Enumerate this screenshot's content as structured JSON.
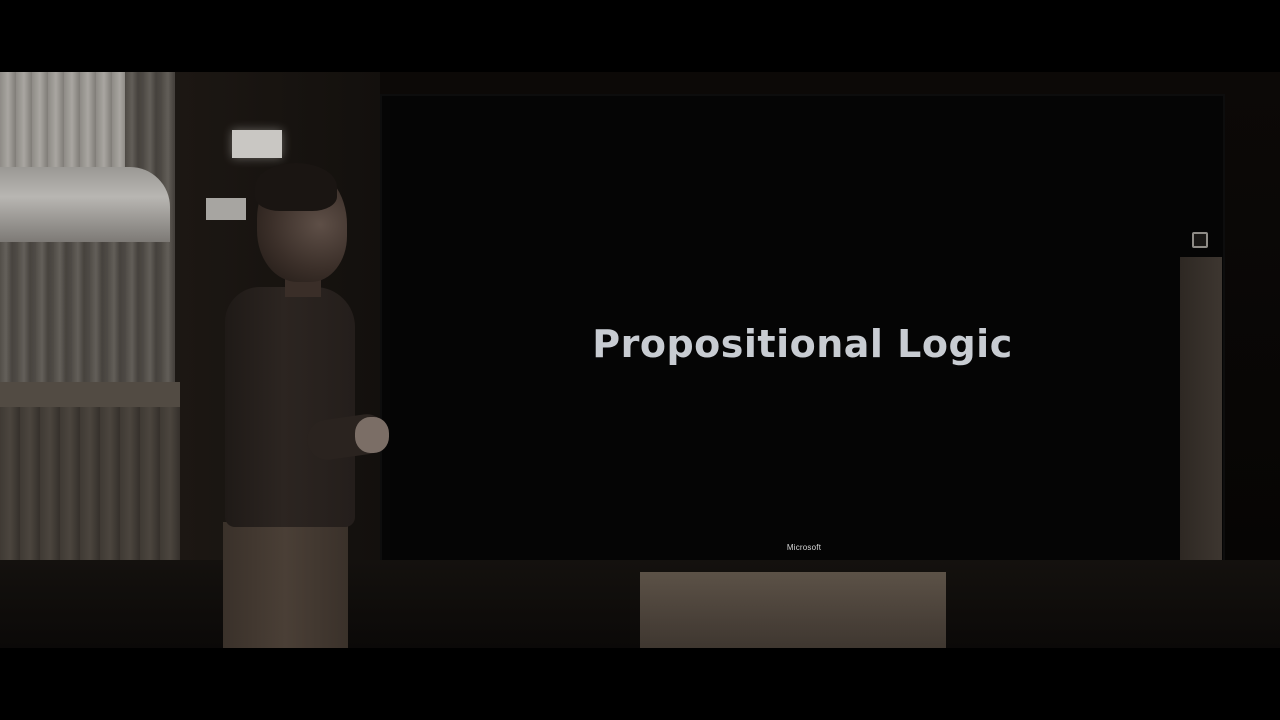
{
  "slide": {
    "title": "Propositional Logic",
    "brand": "Microsoft"
  }
}
